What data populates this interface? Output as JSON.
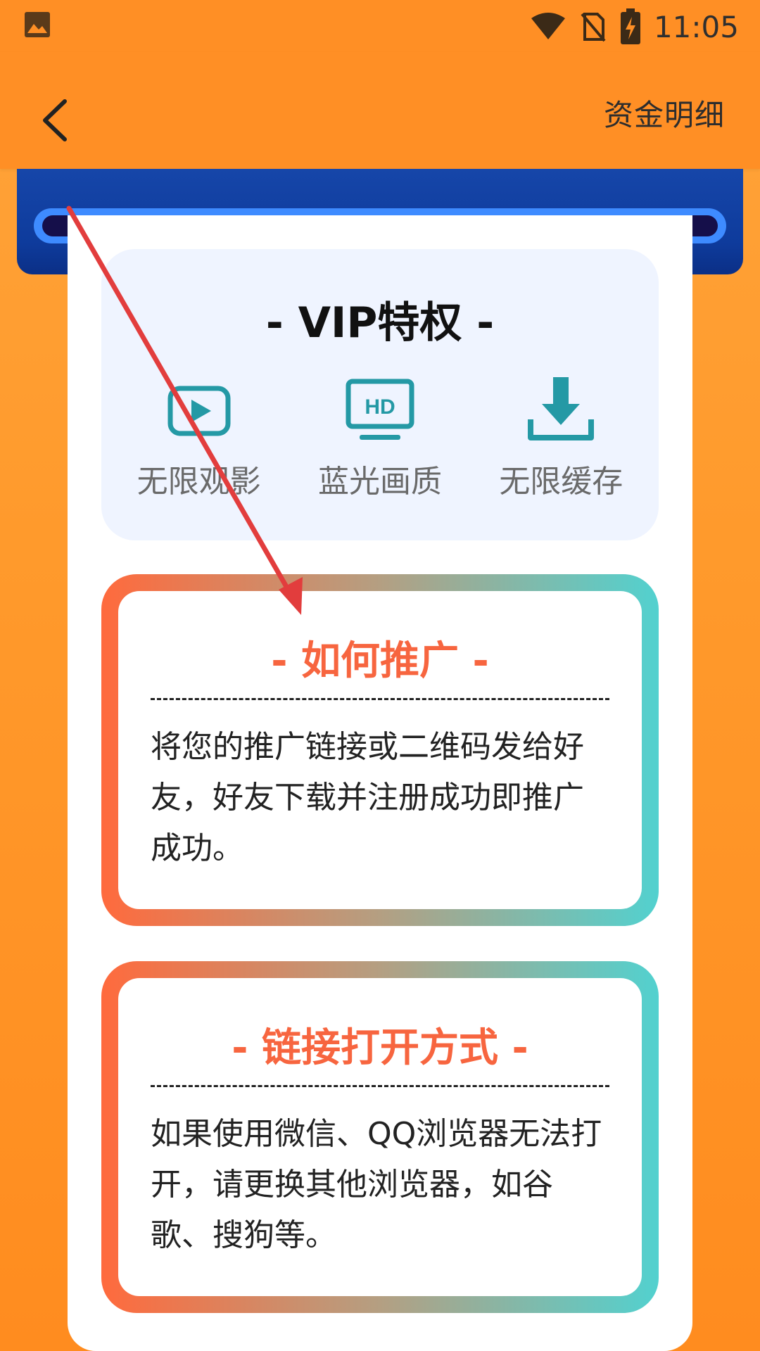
{
  "status_bar": {
    "time": "11:05",
    "icons": [
      "gallery-icon",
      "wifi-icon",
      "no-sim-icon",
      "battery-charging-icon"
    ]
  },
  "app_bar": {
    "back_icon": "chevron-left-icon",
    "details_label": "资金明细"
  },
  "vip": {
    "title": "- VIP特权 -",
    "features": [
      {
        "icon": "play-icon",
        "label": "无限观影"
      },
      {
        "icon": "hd-icon",
        "label": "蓝光画质",
        "badge": "HD"
      },
      {
        "icon": "download-icon",
        "label": "无限缓存"
      }
    ]
  },
  "promote": {
    "title": "- 如何推广 -",
    "body": "将您的推广链接或二维码发给好友，好友下载并注册成功即推广成功。"
  },
  "open_method": {
    "title": "- 链接打开方式 -",
    "body": "如果使用微信、QQ浏览器无法打开，请更换其他浏览器，如谷歌、搜狗等。"
  },
  "colors": {
    "primary_orange": "#ff8f25",
    "banner_blue": "#1646a9",
    "teal_icon": "#2499a5",
    "heading_red": "#f7653f",
    "annotation_arrow": "#e23d3d"
  }
}
